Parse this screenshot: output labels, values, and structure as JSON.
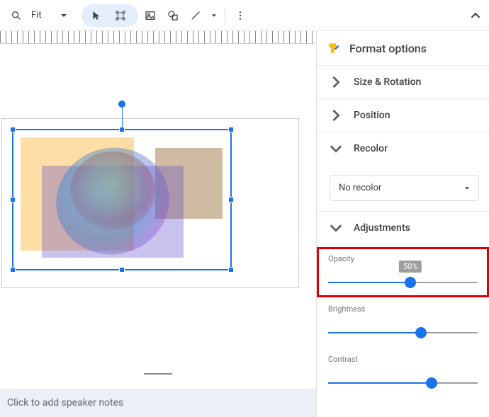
{
  "toolbar": {
    "zoom_label": "Fit"
  },
  "slide": {
    "notes_placeholder": "Click to add speaker notes"
  },
  "panel": {
    "title": "Format options",
    "sections": {
      "size_rotation": "Size & Rotation",
      "position": "Position",
      "recolor": "Recolor",
      "adjustments": "Adjustments"
    },
    "recolor_value": "No recolor",
    "sliders": {
      "opacity": {
        "label": "Opacity",
        "value_text": "50%",
        "percent": 55
      },
      "brightness": {
        "label": "Brightness",
        "percent": 62
      },
      "contrast": {
        "label": "Contrast",
        "percent": 69
      }
    }
  }
}
